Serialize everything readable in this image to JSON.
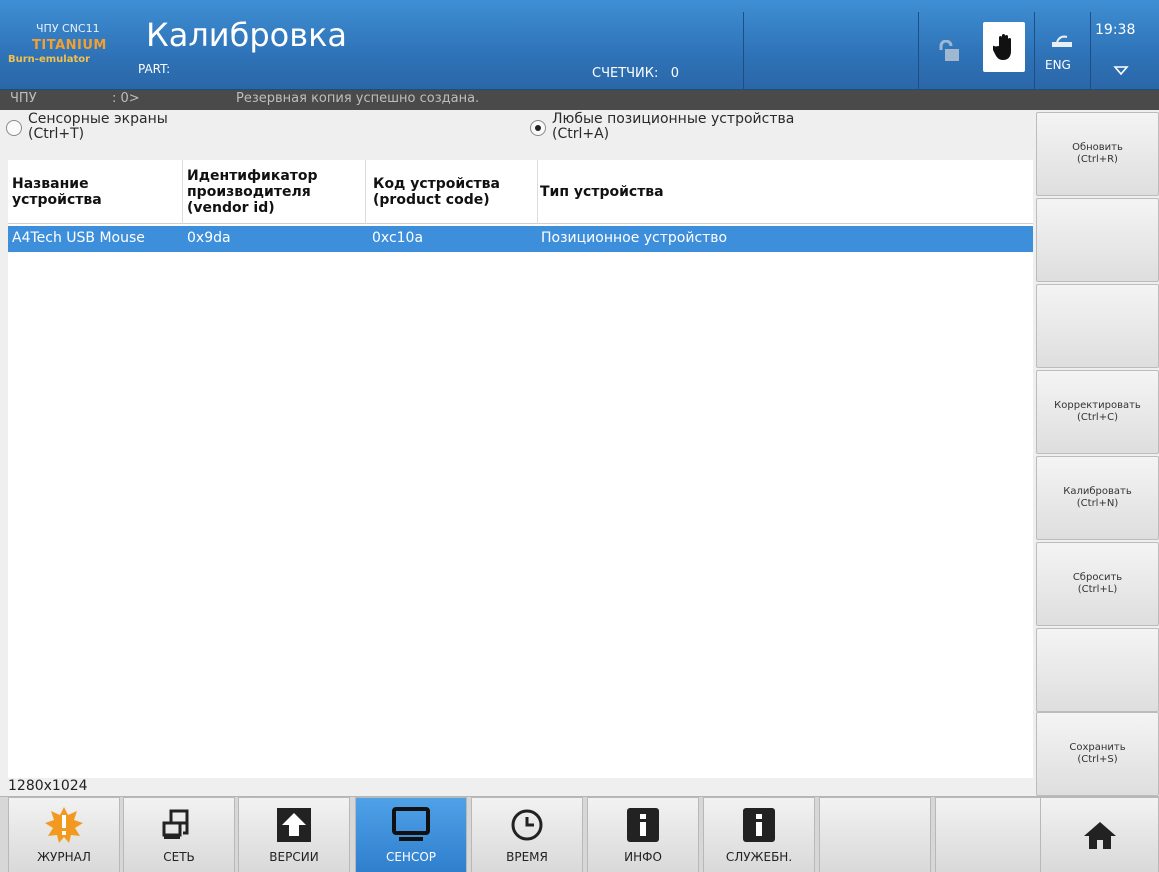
{
  "header": {
    "logo_cnc": "ЧПУ CNC11",
    "logo_titanium": "TITANIUM",
    "logo_burn": "Burn-emulator",
    "title": "Калибровка",
    "part_label": "PART:",
    "counter_label": "СЧЕТЧИК:",
    "counter_value": "0",
    "lang": "ENG",
    "time": "19:38"
  },
  "status": {
    "mode": "ЧПУ",
    "prompt": ": 0>",
    "message": "Резервная копия успешно создана."
  },
  "radios": [
    {
      "label_line1": "Сенсорные экраны",
      "label_line2": "(Ctrl+T)",
      "checked": false
    },
    {
      "label_line1": "Любые позиционные устройства",
      "label_line2": "(Ctrl+A)",
      "checked": true
    }
  ],
  "table": {
    "columns": [
      {
        "line1": "Название",
        "line2": "устройства",
        "line3": ""
      },
      {
        "line1": "Идентификатор",
        "line2": "производителя",
        "line3": "(vendor id)"
      },
      {
        "line1": "Код устройства",
        "line2": "(product code)",
        "line3": ""
      },
      {
        "line1": "Тип устройства",
        "line2": "",
        "line3": ""
      }
    ],
    "rows": [
      {
        "name": "A4Tech USB Mouse",
        "vendor_id": "0x9da",
        "product_code": "0xc10a",
        "type": "Позиционное устройство",
        "selected": true
      }
    ]
  },
  "resolution": "1280x1024",
  "side_buttons": [
    {
      "label": "Обновить",
      "shortcut": "(Ctrl+R)"
    },
    {
      "label": "",
      "shortcut": ""
    },
    {
      "label": "",
      "shortcut": ""
    },
    {
      "label": "Корректировать",
      "shortcut": "(Ctrl+C)"
    },
    {
      "label": "Калибровать",
      "shortcut": "(Ctrl+N)"
    },
    {
      "label": "Сбросить",
      "shortcut": "(Ctrl+L)"
    },
    {
      "label": "",
      "shortcut": ""
    },
    {
      "label": "Сохранить",
      "shortcut": "(Ctrl+S)"
    }
  ],
  "tabs": [
    {
      "label": "ЖУРНАЛ",
      "icon": "warning-burst-icon"
    },
    {
      "label": "СЕТЬ",
      "icon": "network-icon"
    },
    {
      "label": "ВЕРСИИ",
      "icon": "upload-arrow-icon"
    },
    {
      "label": "СЕНСОР",
      "icon": "monitor-icon",
      "active": true
    },
    {
      "label": "ВРЕМЯ",
      "icon": "clock-icon"
    },
    {
      "label": "ИНФО",
      "icon": "info-icon"
    },
    {
      "label": "СЛУЖЕБН.",
      "icon": "info-icon"
    },
    {
      "label": "",
      "icon": ""
    },
    {
      "label": "",
      "icon": ""
    },
    {
      "label": "",
      "icon": "home-icon"
    }
  ],
  "colors": {
    "header": "#2f73b8",
    "selection": "#3d8fdc",
    "active_tab": "#3b8ad8",
    "logo_orange": "#f2a030"
  }
}
